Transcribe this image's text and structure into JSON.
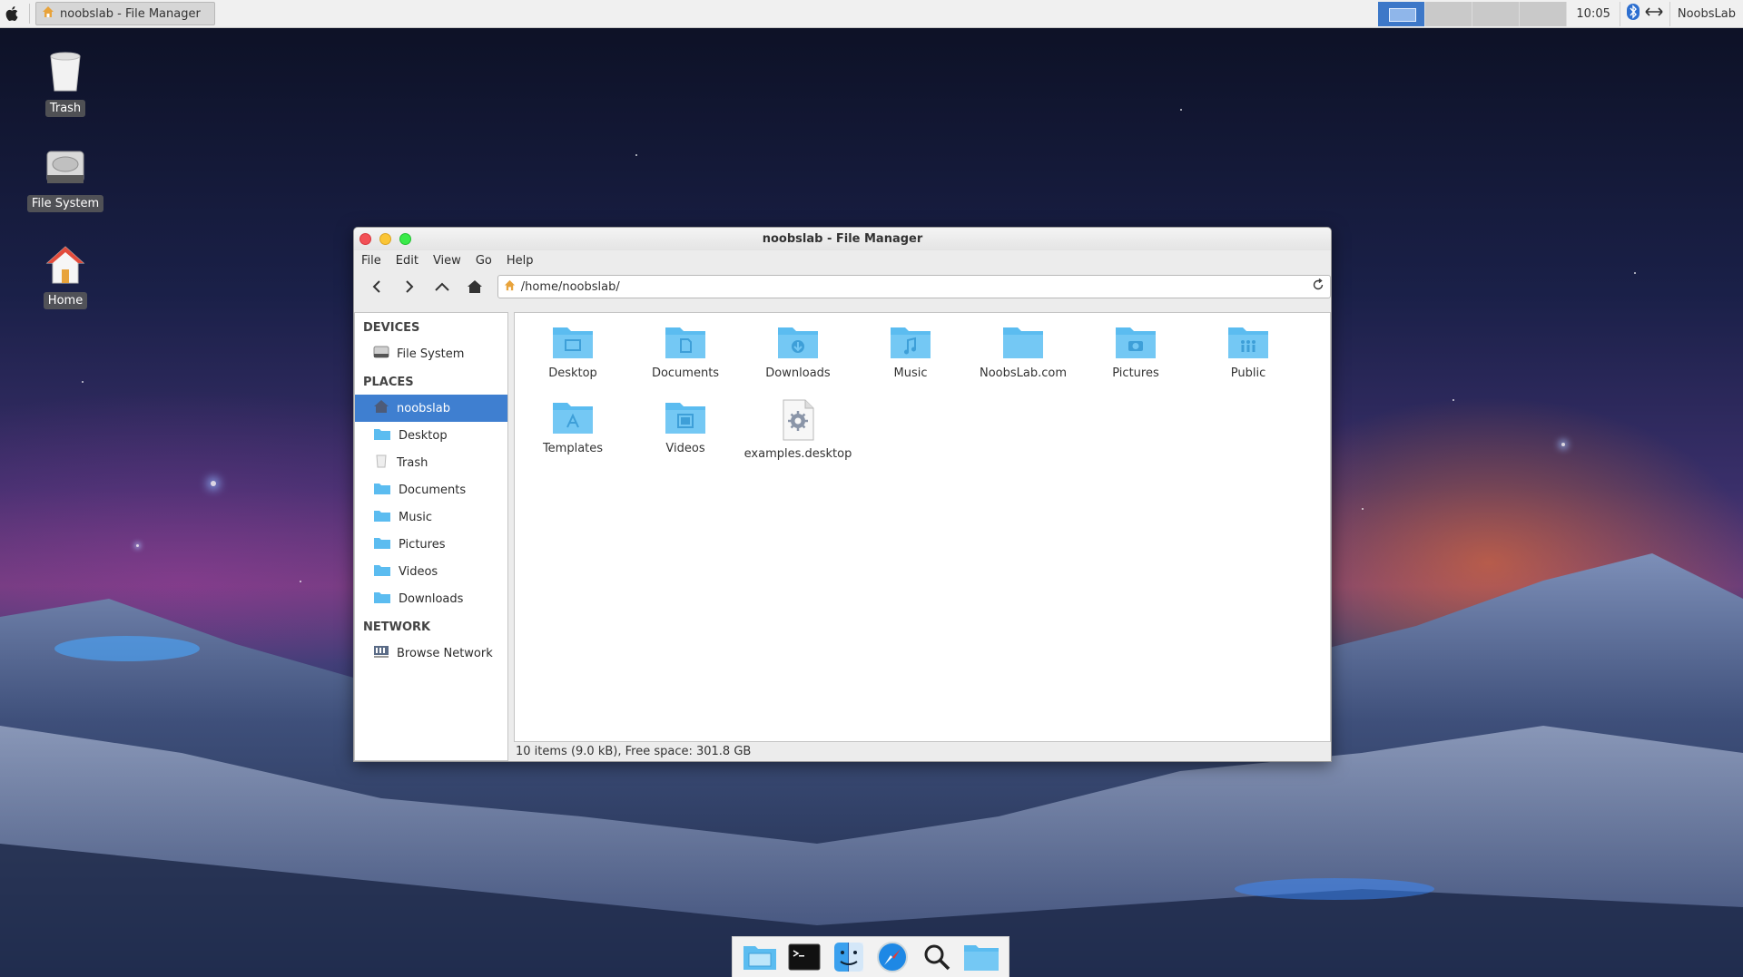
{
  "top_panel": {
    "task_button_label": "noobslab - File Manager",
    "clock": "10:05",
    "username": "NoobsLab",
    "workspaces": 4
  },
  "desktop_icons": [
    {
      "label": "Trash",
      "icon": "trash-icon"
    },
    {
      "label": "File System",
      "icon": "drive-icon"
    },
    {
      "label": "Home",
      "icon": "home-icon"
    }
  ],
  "window": {
    "title": "noobslab - File Manager",
    "menu": [
      "File",
      "Edit",
      "View",
      "Go",
      "Help"
    ],
    "location": "/home/noobslab/",
    "sidebar": {
      "devices_header": "DEVICES",
      "devices": [
        {
          "label": "File System",
          "icon": "drive-icon"
        }
      ],
      "places_header": "PLACES",
      "places": [
        {
          "label": "noobslab",
          "icon": "home-icon",
          "selected": true
        },
        {
          "label": "Desktop",
          "icon": "folder-icon"
        },
        {
          "label": "Trash",
          "icon": "trash-icon"
        },
        {
          "label": "Documents",
          "icon": "folder-icon"
        },
        {
          "label": "Music",
          "icon": "folder-icon"
        },
        {
          "label": "Pictures",
          "icon": "folder-icon"
        },
        {
          "label": "Videos",
          "icon": "folder-icon"
        },
        {
          "label": "Downloads",
          "icon": "folder-icon"
        }
      ],
      "network_header": "NETWORK",
      "network": [
        {
          "label": "Browse Network",
          "icon": "network-icon"
        }
      ]
    },
    "files": [
      {
        "name": "Desktop",
        "icon": "folder-desktop-icon"
      },
      {
        "name": "Documents",
        "icon": "folder-documents-icon"
      },
      {
        "name": "Downloads",
        "icon": "folder-downloads-icon"
      },
      {
        "name": "Music",
        "icon": "folder-music-icon"
      },
      {
        "name": "NoobsLab.com",
        "icon": "folder-icon"
      },
      {
        "name": "Pictures",
        "icon": "folder-pictures-icon"
      },
      {
        "name": "Public",
        "icon": "folder-public-icon"
      },
      {
        "name": "Templates",
        "icon": "folder-templates-icon"
      },
      {
        "name": "Videos",
        "icon": "folder-videos-icon"
      },
      {
        "name": "examples.desktop",
        "icon": "desktop-file-icon"
      }
    ],
    "status": "10 items (9.0 kB), Free space: 301.8 GB"
  },
  "dock": [
    {
      "icon": "file-manager-icon"
    },
    {
      "icon": "terminal-icon"
    },
    {
      "icon": "finder-icon"
    },
    {
      "icon": "safari-icon"
    },
    {
      "icon": "search-icon"
    },
    {
      "icon": "folder-icon"
    }
  ],
  "colors": {
    "selection": "#3f7fd0",
    "folder": "#5bbcf0"
  }
}
